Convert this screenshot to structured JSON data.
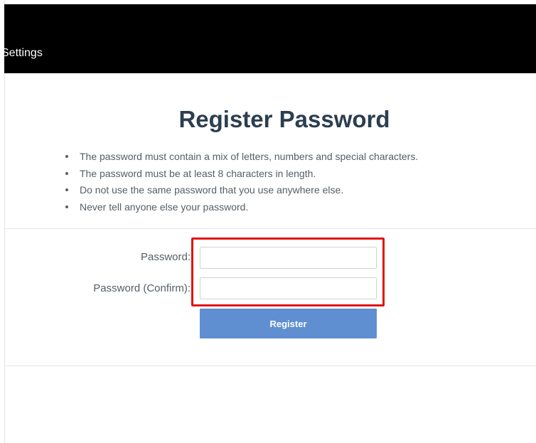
{
  "header": {
    "title": "Settings"
  },
  "page": {
    "title": "Register Password",
    "rules": [
      "The password must contain a mix of letters, numbers and special characters.",
      "The password must be at least 8 characters in length.",
      "Do not use the same password that you use anywhere else.",
      "Never tell anyone else your password."
    ]
  },
  "form": {
    "password_label": "Password:",
    "password_value": "",
    "confirm_label": "Password (Confirm):",
    "confirm_value": "",
    "submit_label": "Register"
  },
  "colors": {
    "header_bg": "#000000",
    "title_text": "#2c3e50",
    "button_bg": "#5f8fd1",
    "highlight": "#e31212"
  }
}
